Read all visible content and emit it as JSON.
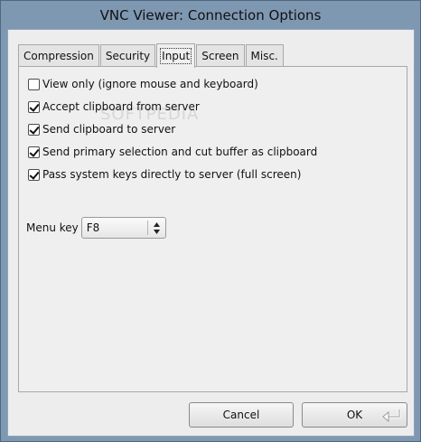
{
  "window": {
    "title": "VNC Viewer: Connection Options"
  },
  "tabs": [
    {
      "label": "Compression"
    },
    {
      "label": "Security"
    },
    {
      "label": "Input"
    },
    {
      "label": "Screen"
    },
    {
      "label": "Misc."
    }
  ],
  "active_tab": "Input",
  "input": {
    "options": [
      {
        "label": "View only (ignore mouse and keyboard)",
        "checked": false
      },
      {
        "label": "Accept clipboard from server",
        "checked": true
      },
      {
        "label": "Send clipboard to server",
        "checked": true
      },
      {
        "label": "Send primary selection and cut buffer as clipboard",
        "checked": true
      },
      {
        "label": "Pass system keys directly to server (full screen)",
        "checked": true
      }
    ],
    "menu_key_label": "Menu key",
    "menu_key_value": "F8"
  },
  "buttons": {
    "cancel": "Cancel",
    "ok": "OK"
  },
  "watermark": "SOFTPEDIA",
  "icons": {
    "checkbox_checked": "checkmark-icon",
    "select_arrows": "up-down-arrows-icon",
    "ok_enter": "enter-key-icon"
  }
}
